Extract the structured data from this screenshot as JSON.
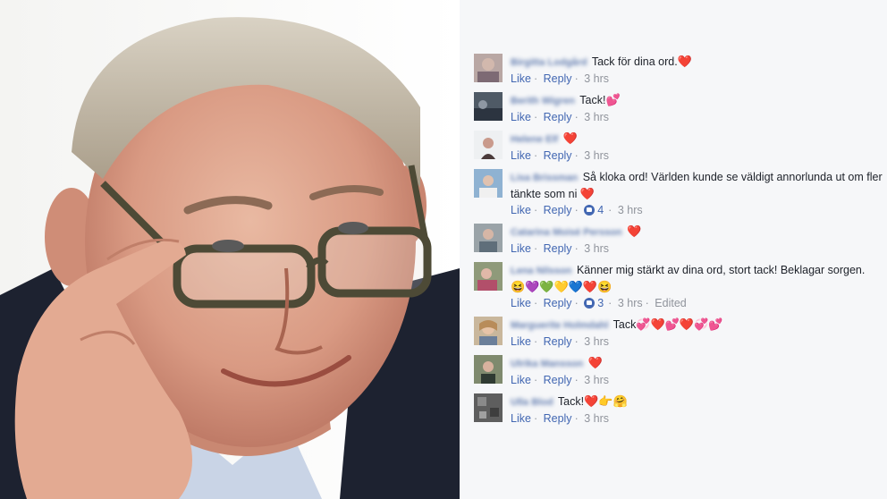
{
  "comments": [
    {
      "name": "Birgitta Lodgård",
      "text": "Tack för dina ord.",
      "emoji": "❤️",
      "actions": {
        "like": "Like",
        "reply": "Reply",
        "time": "3 hrs"
      }
    },
    {
      "name": "Berith Wigren",
      "text": "Tack!",
      "emoji": "💕",
      "actions": {
        "like": "Like",
        "reply": "Reply",
        "time": "3 hrs"
      }
    },
    {
      "name": "Helene Elf",
      "text": "",
      "emoji": "❤️",
      "actions": {
        "like": "Like",
        "reply": "Reply",
        "time": "3 hrs"
      }
    },
    {
      "name": "Lisa Brissman",
      "text": "Så kloka ord! Världen kunde se väldigt annorlunda ut om fler",
      "text2": "tänkte som ni",
      "emoji": "❤️",
      "actions": {
        "like": "Like",
        "reply": "Reply",
        "reactions": "4",
        "time": "3 hrs"
      }
    },
    {
      "name": "Catarina Moisé Persson",
      "text": "",
      "emoji": "❤️",
      "actions": {
        "like": "Like",
        "reply": "Reply",
        "time": "3 hrs"
      }
    },
    {
      "name": "Lena Nilsson",
      "text": "Känner mig stärkt av dina ord, stort tack! Beklagar sorgen.",
      "emoji2": "😆💜💚💛💙❤️😆",
      "actions": {
        "like": "Like",
        "reply": "Reply",
        "reactions": "3",
        "time": "3 hrs",
        "edited": "Edited"
      }
    },
    {
      "name": "Marguerite Holmdahl",
      "text": "Tack",
      "emoji": "💞❤️💕❤️💞💕",
      "actions": {
        "like": "Like",
        "reply": "Reply",
        "time": "3 hrs"
      }
    },
    {
      "name": "Ulrika Mansson",
      "text": "",
      "emoji": "❤️",
      "actions": {
        "like": "Like",
        "reply": "Reply",
        "time": "3 hrs"
      }
    },
    {
      "name": "Ulla Blod",
      "text": "Tack!",
      "emoji": "❤️👉🤗",
      "actions": {
        "like": "Like",
        "reply": "Reply",
        "time": "3 hrs"
      }
    }
  ],
  "colors": {
    "link": "#4267b2",
    "name": "#365899",
    "meta": "#90949c",
    "text": "#1d2129",
    "panel": "#f6f7f9"
  }
}
